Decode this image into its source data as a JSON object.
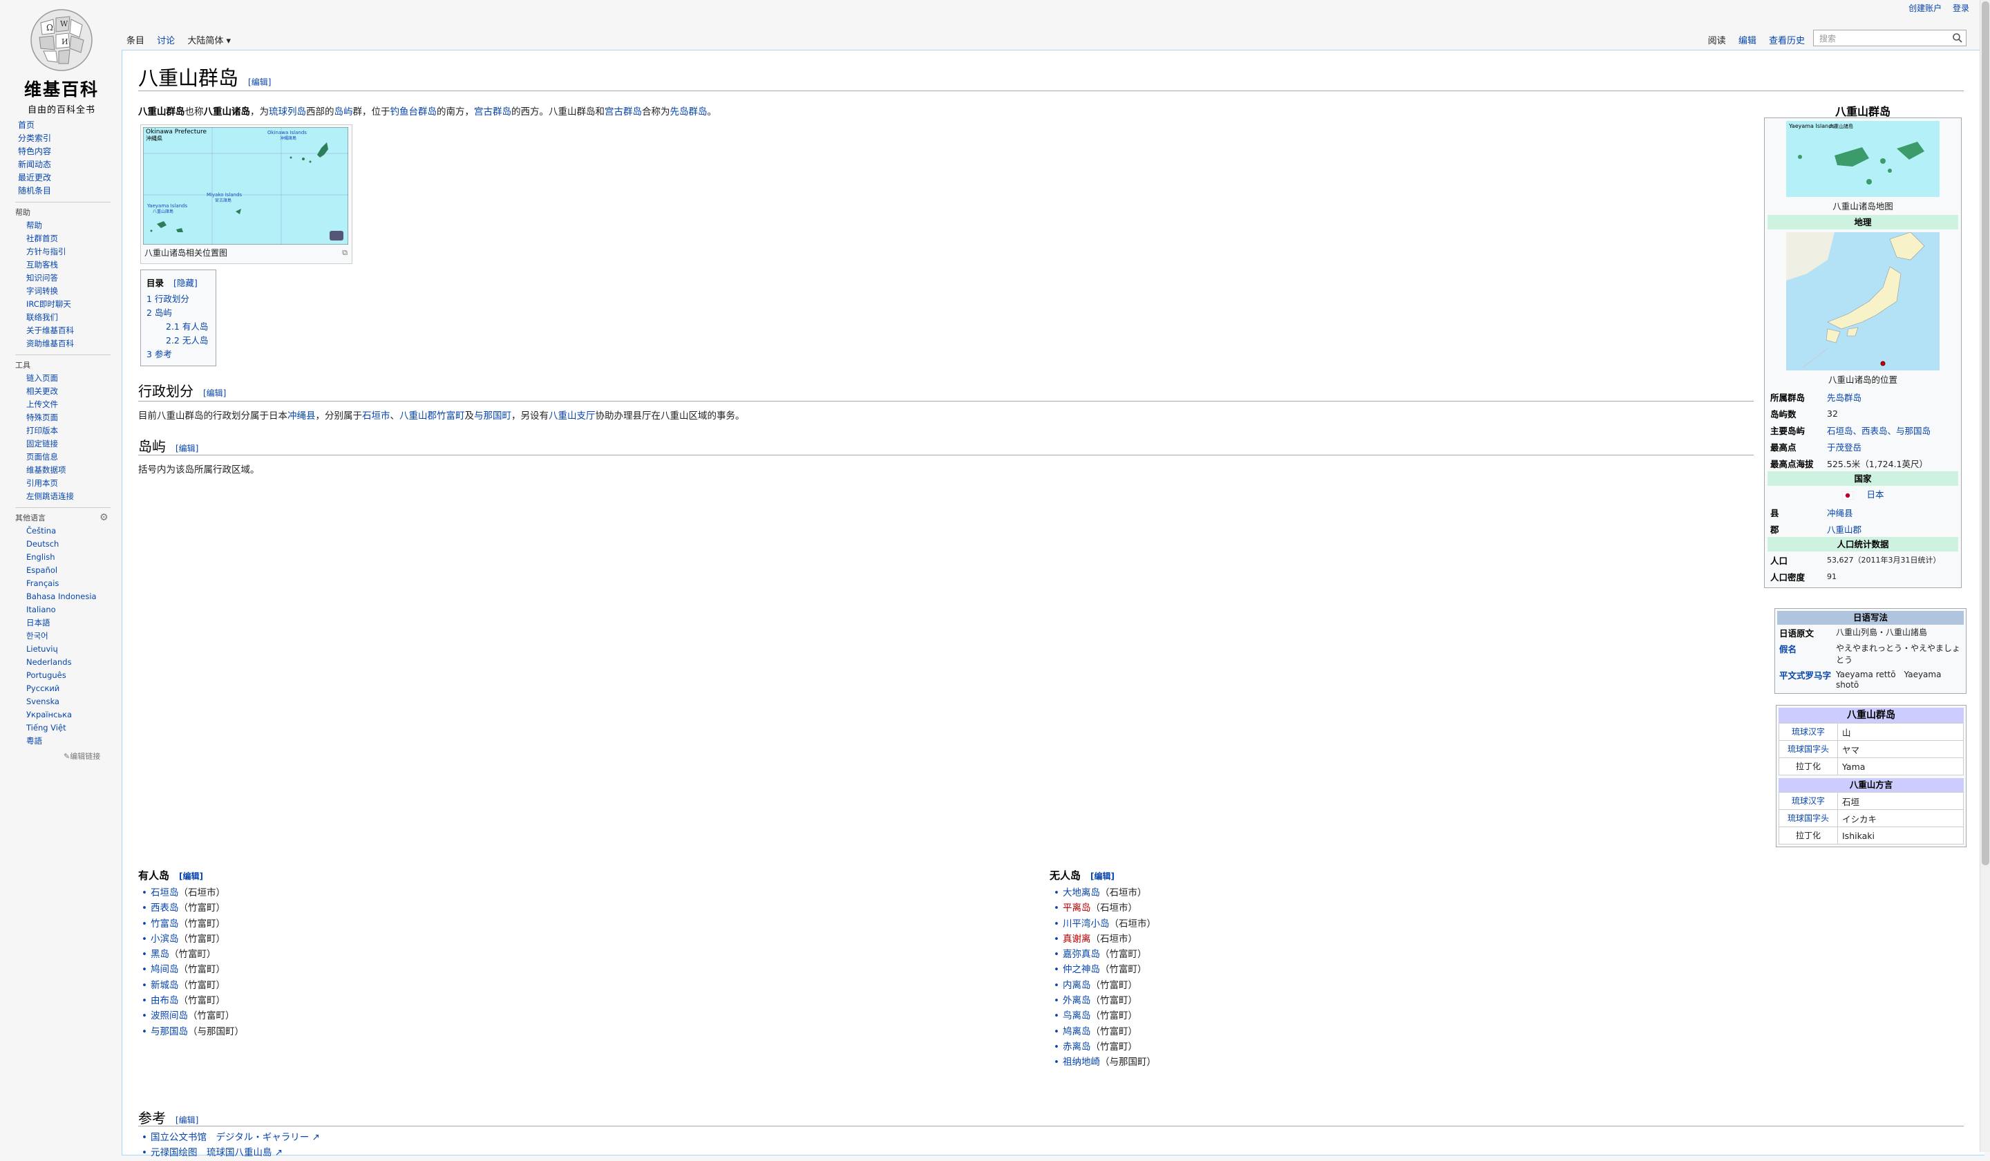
{
  "personal": {
    "create_account": "创建账户",
    "login": "登录"
  },
  "logo": {
    "name": "维基百科",
    "tagline": "自由的百科全书"
  },
  "sidebar": {
    "nav": [
      "首页",
      "分类索引",
      "特色内容",
      "新闻动态",
      "最近更改",
      "随机条目"
    ],
    "help_head": "帮助",
    "help": [
      "帮助",
      "社群首页",
      "方针与指引",
      "互助客栈",
      "知识问答",
      "字词转换",
      "IRC即时聊天",
      "联络我们",
      "关于维基百科",
      "资助维基百科"
    ],
    "tools_head": "工具",
    "tools": [
      "链入页面",
      "相关更改",
      "上传文件",
      "特殊页面",
      "打印版本",
      "固定链接",
      "页面信息",
      "维基数据项",
      "引用本页",
      "左侧跳语连接"
    ],
    "lang_head": "其他语言",
    "langs": [
      "Čeština",
      "Deutsch",
      "English",
      "Español",
      "Français",
      "Bahasa Indonesia",
      "Italiano",
      "日本語",
      "한국어",
      "Lietuvių",
      "Nederlands",
      "Português",
      "Русский",
      "Svenska",
      "Українська",
      "Tiếng Việt",
      "粵語"
    ],
    "edit_links": "✎编辑链接"
  },
  "tabs": {
    "left": [
      "条目",
      "讨论",
      "大陆简体 ▾"
    ],
    "right": [
      "阅读",
      "编辑",
      "查看历史"
    ],
    "search_placeholder": "搜索"
  },
  "article": {
    "title": "八重山群岛",
    "edit": "[编辑]",
    "lead": [
      {
        "t": "八重山群岛",
        "b": true
      },
      {
        "t": "也称"
      },
      {
        "t": "八重山诸岛",
        "b": true
      },
      {
        "t": "，为"
      },
      {
        "t": "琉球列岛",
        "l": true
      },
      {
        "t": "西部的"
      },
      {
        "t": "岛屿",
        "l": true
      },
      {
        "t": "群，位于"
      },
      {
        "t": "钓鱼台群岛",
        "l": true
      },
      {
        "t": "的南方，"
      },
      {
        "t": "宫古群岛",
        "l": true
      },
      {
        "t": "的西方。八重山群岛和"
      },
      {
        "t": "宫古群岛",
        "l": true
      },
      {
        "t": "合称为"
      },
      {
        "t": "先岛群岛",
        "l": true
      },
      {
        "t": "。"
      }
    ],
    "map_caption": "八重山诸岛相关位置图",
    "map_labels": {
      "okinawa_pref": "Okinawa Prefecture",
      "okinawa_pref_jp": "沖縄県",
      "okinawa_islands": "Okinawa Islands",
      "okinawa_islands_jp": "沖縄諸島",
      "miyako_islands": "Miyako Islands",
      "miyako_islands_jp": "宮古諸島",
      "yaeyama_islands": "Yaeyama Islands",
      "yaeyama_islands_jp": "八重山諸島"
    },
    "toc": {
      "title": "目录",
      "hide": "[隐藏]",
      "items": [
        "1 行政划分",
        "2 岛屿",
        "2.1 有人岛",
        "2.2 无人岛",
        "3 参考"
      ]
    },
    "sec1": {
      "title": "行政划分",
      "text": [
        {
          "t": "目前八重山群岛的行政划分属于日本"
        },
        {
          "t": "冲绳县",
          "l": true
        },
        {
          "t": "，分别属于"
        },
        {
          "t": "石垣市",
          "l": true
        },
        {
          "t": "、"
        },
        {
          "t": "八重山郡",
          "l": true
        },
        {
          "t": "竹富町",
          "l": true
        },
        {
          "t": "及"
        },
        {
          "t": "与那国町",
          "l": true
        },
        {
          "t": "，另设有"
        },
        {
          "t": "八重山支厅",
          "l": true
        },
        {
          "t": "协助办理县厅在八重山区域的事务。"
        }
      ]
    },
    "sec2": {
      "title": "岛屿",
      "text": "括号内为该岛所属行政区域。"
    },
    "inhabited": {
      "title": "有人岛",
      "items": [
        {
          "name": "石垣岛",
          "par": "（石垣市）"
        },
        {
          "name": "西表岛",
          "par": "（竹富町）"
        },
        {
          "name": "竹富岛",
          "par": "（竹富町）"
        },
        {
          "name": "小滨岛",
          "par": "（竹富町）"
        },
        {
          "name": "黑岛",
          "par": "（竹富町）"
        },
        {
          "name": "鸠间岛",
          "par": "（竹富町）"
        },
        {
          "name": "新城岛",
          "par": "（竹富町）"
        },
        {
          "name": "由布岛",
          "par": "（竹富町）"
        },
        {
          "name": "波照间岛",
          "par": "（竹富町）"
        },
        {
          "name": "与那国岛",
          "par": "（与那国町）"
        }
      ]
    },
    "uninhabited": {
      "title": "无人岛",
      "items": [
        {
          "name": "大地离岛",
          "par": "（石垣市）",
          "red": false
        },
        {
          "name": "平离岛",
          "par": "（石垣市）",
          "red": true
        },
        {
          "name": "川平湾小岛",
          "par": "（石垣市）",
          "red": false
        },
        {
          "name": "真谢离",
          "par": "（石垣市）",
          "red": true
        },
        {
          "name": "嘉弥真岛",
          "par": "（竹富町）",
          "red": false
        },
        {
          "name": "仲之神岛",
          "par": "（竹富町）",
          "red": false
        },
        {
          "name": "内离岛",
          "par": "（竹富町）",
          "red": false
        },
        {
          "name": "外离岛",
          "par": "（竹富町）",
          "red": false
        },
        {
          "name": "鸟离岛",
          "par": "（竹富町）",
          "red": false
        },
        {
          "name": "鸠离岛",
          "par": "（竹富町）",
          "red": false
        },
        {
          "name": "赤离岛",
          "par": "（竹富町）",
          "red": false
        },
        {
          "name": "祖纳地崎",
          "par": "（与那国町）",
          "red": false
        }
      ]
    },
    "sec3": {
      "title": "参考",
      "refs": [
        "国立公文书馆　デジタル・ギャラリー",
        "元禄国绘图　琉球国八重山島"
      ]
    }
  },
  "infobox": {
    "title": "八重山群岛",
    "map1_caption": "八重山诸岛地图",
    "map1_label": "Yaeyama Islands",
    "map1_label_jp": "八重山諸島",
    "geo": "地理",
    "map2_caption": "八重山诸岛的位置",
    "rows1": [
      {
        "k": "所属群岛",
        "v": "先岛群岛",
        "link": true
      },
      {
        "k": "岛屿数",
        "v": "32",
        "link": false
      },
      {
        "k": "主要岛屿",
        "v": "石垣岛、西表岛、与那国岛",
        "link": true
      },
      {
        "k": "最高点",
        "v": "于茂登岳",
        "link": true
      },
      {
        "k": "最高点海拔",
        "v": "525.5米（1,724.1英尺）",
        "link": false
      }
    ],
    "country_head": "国家",
    "country": "日本",
    "rows2": [
      {
        "k": "县",
        "v": "冲绳县",
        "link": true
      },
      {
        "k": "郡",
        "v": "八重山郡",
        "link": true
      }
    ],
    "pop_head": "人口统计数据",
    "pop": {
      "k": "人口",
      "v": "53,627（2011年3月31日统计）"
    },
    "density": {
      "k": "人口密度",
      "v": "91"
    }
  },
  "japanese": {
    "head": "日语写法",
    "rows": [
      {
        "k": "日语原文",
        "v": "八重山列島・八重山諸島",
        "link": false
      },
      {
        "k": "假名",
        "v": "やえやまれっとう・やえやましょとう",
        "link": true
      },
      {
        "k": "平文式罗马字",
        "v": "Yaeyama rettō　Yaeyama shotō",
        "link": true
      }
    ]
  },
  "ryukyu1": {
    "head": "八重山群岛",
    "rows": [
      {
        "k": "琉球汉字",
        "v": "山",
        "link": true
      },
      {
        "k": "琉球国字头",
        "v": "ヤマ",
        "link": true
      },
      {
        "k": "拉丁化",
        "v": "Yama",
        "link": false
      }
    ]
  },
  "ryukyu2": {
    "head": "八重山方言",
    "rows": [
      {
        "k": "琉球汉字",
        "v": "石垣",
        "link": true
      },
      {
        "k": "琉球国字头",
        "v": "イシカキ",
        "link": true
      },
      {
        "k": "拉丁化",
        "v": "Ishikaki",
        "link": false
      }
    ]
  },
  "colors": {
    "link": "#0645ad",
    "redlink": "#ba0000",
    "geo_bar": "#cef2e0",
    "jp_bar": "#b0c4de",
    "ry_bar": "#ccccff",
    "sea": "#b3f0f7"
  }
}
